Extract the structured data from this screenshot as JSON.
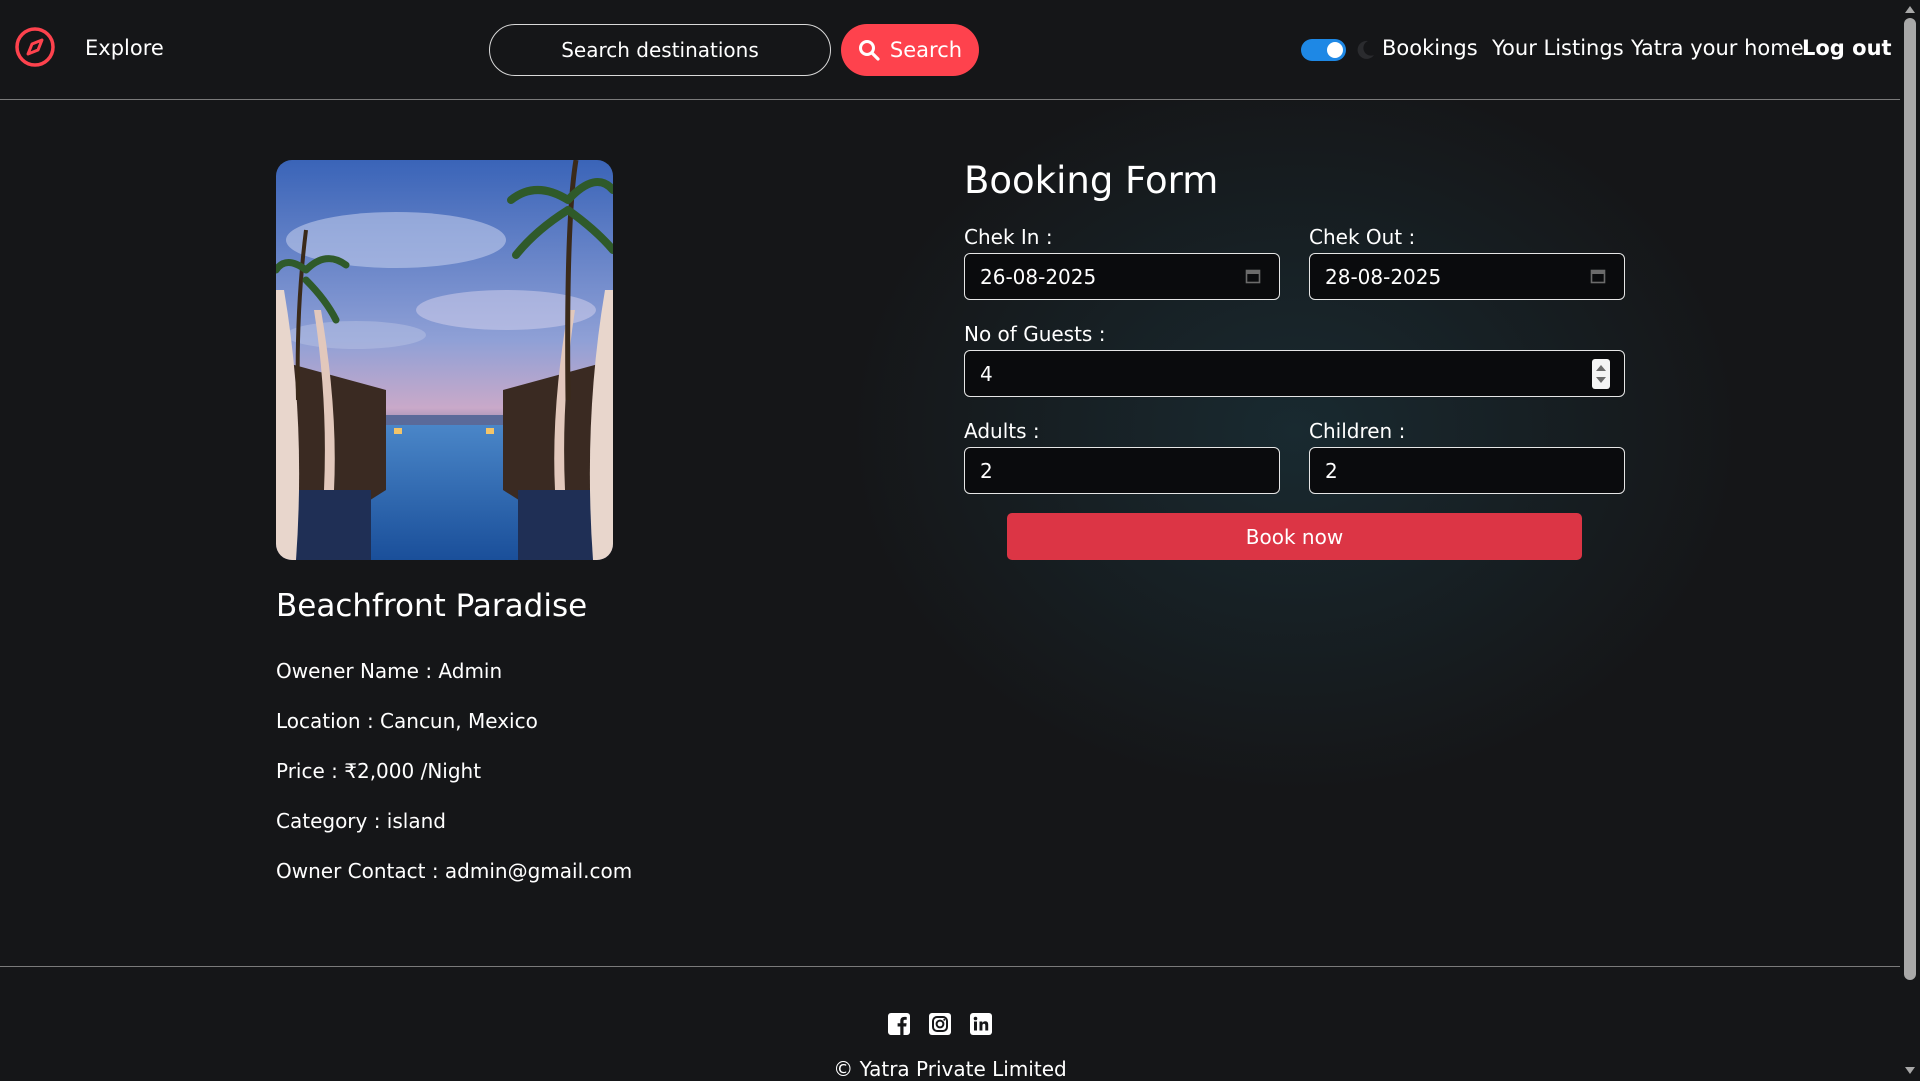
{
  "colors": {
    "brand": "#fe424d",
    "book_button": "#dc3545",
    "toggle_on": "#1e88e5",
    "background": "#151618"
  },
  "navbar": {
    "brand_icon": "compass-icon",
    "explore_label": "Explore",
    "search": {
      "placeholder": "Search destinations",
      "button_label": "Search",
      "button_icon": "search-icon"
    },
    "theme_toggle": {
      "state": "on",
      "icon": "moon-icon"
    },
    "links": {
      "bookings": "Bookings",
      "listings": "Your Listings",
      "home": "Yatra your home",
      "logout": "Log out"
    }
  },
  "listing": {
    "title": "Beachfront Paradise",
    "owner_line": "Owener Name : Admin",
    "location_line": "Location : Cancun, Mexico",
    "price_line": "Price : ₹2,000 /Night",
    "category_line": "Category : island",
    "contact_line": "Owner Contact : admin@gmail.com"
  },
  "booking_form": {
    "title": "Booking Form",
    "checkin": {
      "label": "Chek In :",
      "value": "26-08-2025"
    },
    "checkout": {
      "label": "Chek Out :",
      "value": "28-08-2025"
    },
    "guests": {
      "label": "No of Guests :",
      "value": "4"
    },
    "adults": {
      "label": "Adults :",
      "value": "2"
    },
    "children": {
      "label": "Children :",
      "value": "2"
    },
    "submit_label": "Book now"
  },
  "footer": {
    "socials": [
      "facebook-icon",
      "instagram-icon",
      "linkedin-icon"
    ],
    "copyright": "© Yatra Private Limited"
  }
}
